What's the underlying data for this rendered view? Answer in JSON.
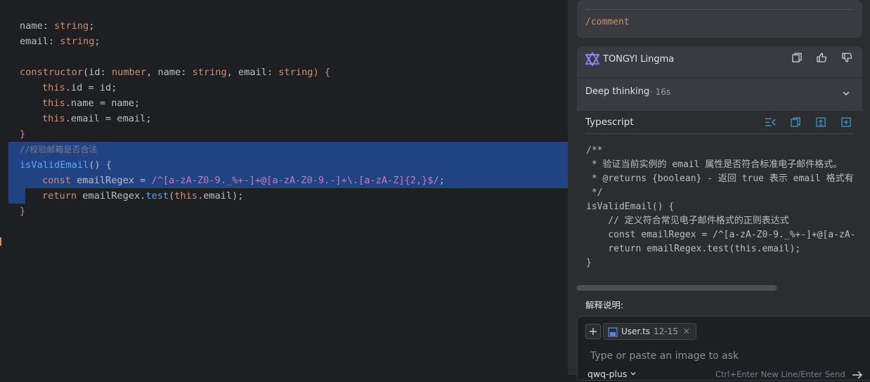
{
  "editor": {
    "lines": {
      "l1": {
        "prop": "name",
        "colon": ": ",
        "type": "string",
        "semi": ";"
      },
      "l2": {
        "prop": "email",
        "colon": ": ",
        "type": "string",
        "semi": ";"
      },
      "l4": {
        "kw": "constructor",
        "p1": "(id",
        "c1": ": ",
        "t1": "number",
        "p2": ", name",
        "c2": ": ",
        "t2": "string",
        "p3": ", email",
        "c3": ": ",
        "t3": "string",
        "end": ") {"
      },
      "l5": {
        "th": "this",
        "rest": ".id = id;"
      },
      "l6": {
        "th": "this",
        "rest": ".name = name;"
      },
      "l7": {
        "th": "this",
        "rest": ".email = email;"
      },
      "l8": {
        "text": "}"
      },
      "l9": {
        "text": "//校验邮箱是否合法"
      },
      "l10": {
        "fn": "isValidEmail",
        "rest": "() {"
      },
      "l11": {
        "kw": "const",
        "mid": " emailRegex = ",
        "regex": "/^[a-zA-Z0-9._%+-]+@[a-zA-Z0-9.-]+\\.[a-zA-Z]{2,}$/",
        "semi": ";"
      },
      "l12": {
        "kw": "return",
        "mid": " emailRegex.",
        "fn": "test",
        "open": "(",
        "th": "this",
        "rest": ".email);"
      },
      "l13": {
        "text": "}"
      }
    }
  },
  "chat": {
    "prev_message": "/comment",
    "assistant_name": "TONGYI Lingma",
    "thinking_label": "Deep thinking",
    "thinking_time": "· 16s",
    "code_lang": "Typescript",
    "code_lines": [
      "/**",
      " * 验证当前实例的 email 属性是否符合标准电子邮件格式。",
      " * @returns {boolean} - 返回 true 表示 email 格式有",
      " */",
      "isValidEmail() {",
      "    // 定义符合常见电子邮件格式的正则表达式",
      "    const emailRegex = /^[a-zA-Z0-9._%+-]+@[a-zA-",
      "    return emailRegex.test(this.email);",
      "}"
    ],
    "explanation_heading": "解释说明:",
    "context_file": "User.ts",
    "context_range": "12-15",
    "input_placeholder": "Type or paste an image to ask",
    "model_name": "qwq-plus",
    "send_hint": "Ctrl+Enter New Line/Enter Send"
  },
  "colors": {
    "editor_bg": "#1e1f22",
    "selection": "#214283",
    "panel_bg": "#2b2d30",
    "card_bg": "#393b40",
    "accent_blue": "#3592c4"
  }
}
